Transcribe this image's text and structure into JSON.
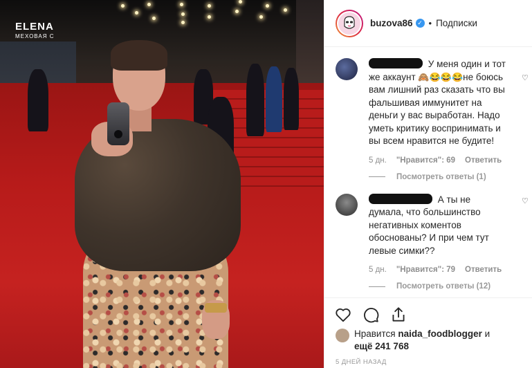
{
  "photo": {
    "logo_main": "ELENA",
    "logo_sub": "МЕХОВАЯ С"
  },
  "header": {
    "username": "buzova86",
    "separator": "•",
    "follow_label": "Подписки",
    "verified_icon": "verified-check-icon"
  },
  "comments": [
    {
      "text_1": "У меня один и тот же аккаунт",
      "emoji": "🙈😂😂😂",
      "text_2": "не боюсь вам лишний раз сказать что вы фальшивая иммунитет на деньги у вас выработан. Надо уметь критику воспринимать и вы всем нравится не будите!",
      "age": "5 дн.",
      "likes": "\"Нравится\": 69",
      "reply": "Ответить",
      "view_replies": "Посмотреть ответы (1)"
    },
    {
      "text": "А ты не думала, что большинство негативных коментов обоснованы? И при чем тут левые симки??",
      "age": "5 дн.",
      "likes": "\"Нравится\": 79",
      "reply": "Ответить",
      "view_replies": "Посмотреть ответы (12)"
    }
  ],
  "likes": {
    "prefix": "Нравится",
    "user": "naida_foodblogger",
    "conj": "и",
    "more": "ещё 241 768"
  },
  "date": "5 дней назад",
  "colors": {
    "accent_blue": "#3897f0",
    "text": "#262626",
    "muted": "#8e8e8e"
  }
}
